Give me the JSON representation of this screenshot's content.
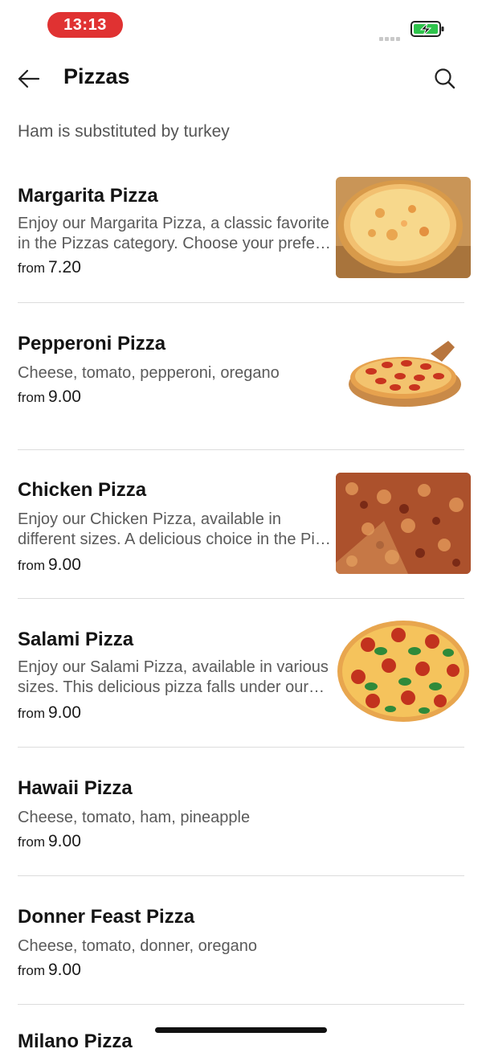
{
  "status_bar": {
    "time": "13:13",
    "battery_color": "#2ec44c",
    "time_pill_color": "#e03232"
  },
  "header": {
    "title": "Pizzas"
  },
  "notice": "Ham is substituted by turkey",
  "items": [
    {
      "name": "Margarita Pizza",
      "description": "Enjoy our Margarita Pizza, a classic favorite in the Pizzas category. Choose your prefe…",
      "from_label": "from",
      "price": "7.20",
      "image": "margarita-pizza-photo"
    },
    {
      "name": "Pepperoni Pizza",
      "description": "Cheese, tomato, pepperoni, oregano",
      "from_label": "from",
      "price": "9.00",
      "image": "pepperoni-pizza-photo"
    },
    {
      "name": "Chicken Pizza",
      "description": "Enjoy our Chicken Pizza, available in different sizes. A delicious choice in the Pi…",
      "from_label": "from",
      "price": "9.00",
      "image": "chicken-pizza-photo"
    },
    {
      "name": "Salami Pizza",
      "description": "Enjoy our Salami Pizza, available in various sizes. This delicious pizza falls under our…",
      "from_label": "from",
      "price": "9.00",
      "image": "salami-pizza-photo"
    },
    {
      "name": "Hawaii Pizza",
      "description": "Cheese, tomato, ham, pineapple",
      "from_label": "from",
      "price": "9.00"
    },
    {
      "name": "Donner Feast Pizza",
      "description": "Cheese, tomato, donner, oregano",
      "from_label": "from",
      "price": "9.00"
    }
  ],
  "partial_item_name": "Milano Pizza"
}
